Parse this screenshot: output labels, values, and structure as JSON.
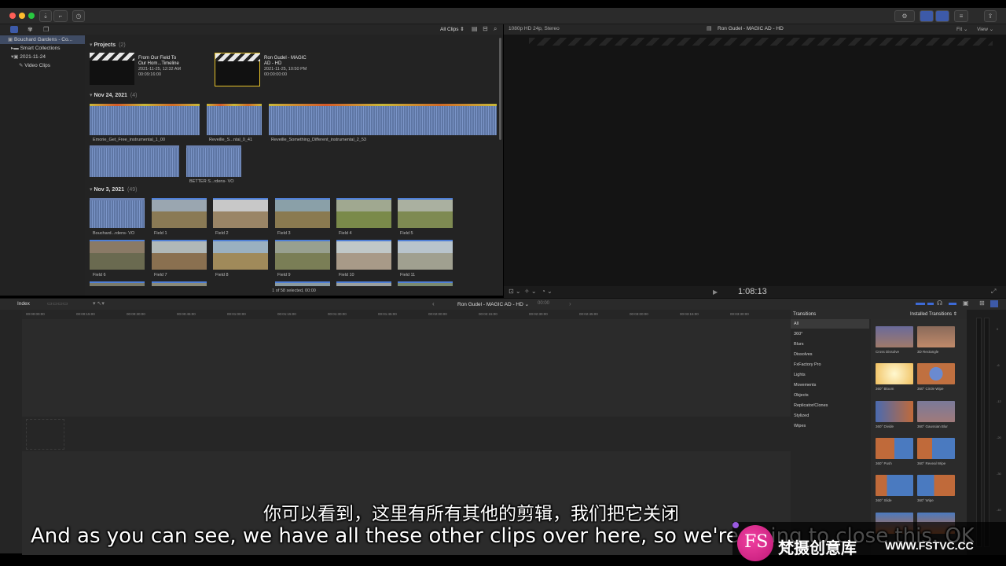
{
  "topbar": {
    "traffic_colors": [
      "#ff5f57",
      "#febc2e",
      "#28c840"
    ]
  },
  "library": {
    "items": [
      {
        "label": "Bouchard Gardens - Co...",
        "icon": "library-icon"
      },
      {
        "label": "Smart Collections",
        "icon": "folder-icon"
      },
      {
        "label": "2021-11-24",
        "icon": "event-icon"
      },
      {
        "label": "Video Clips",
        "icon": "keyword-icon"
      }
    ]
  },
  "browser": {
    "toolbar": {
      "filter": "All Clips ⇕"
    },
    "projects": {
      "label": "Projects",
      "count": "(2)",
      "items": [
        {
          "title1": "From Our Field To",
          "title2": "Our Hom...Timeline",
          "date": "2021-11-25, 12:32 AM",
          "duration": "00:09:16:00"
        },
        {
          "title1": "Ron Gudel - MAGIC",
          "title2": "AD - HD",
          "date": "2021-11-25, 10:50 PM",
          "duration": "00:00:00:00"
        }
      ]
    },
    "nov24": {
      "label": "Nov 24, 2021",
      "count": "(4)",
      "clips": [
        "Emorie_Get_Free_instrumental_1_00",
        "Reveille_S...ntal_0_41",
        "Reveille_Something_Different_instrumental_2_53",
        "BETTER S...rdens- VO"
      ]
    },
    "nov3": {
      "label": "Nov 3, 2021",
      "count": "(49)",
      "clips": [
        "Bouchard...rdens- VO",
        "Field 1",
        "Field 2",
        "Field 3",
        "Field 4",
        "Field 5",
        "Field 6",
        "Field 7",
        "Field 8",
        "Field 9",
        "Field 10",
        "Field 11"
      ]
    },
    "status": "1 of 58 selected, 00:00"
  },
  "viewer": {
    "format": "1080p HD 24p, Stereo",
    "title": "Ron Gudel - MAGIC AD - HD",
    "fit": "Fit ⌄",
    "view": "View ⌄",
    "timecode": "1:08:13"
  },
  "timeline": {
    "index": "Index",
    "project": "Ron Gudel - MAGIC AD - HD ⌄",
    "duration": "00:00",
    "ruler": [
      "00:00:00:00",
      "00:00:15:00",
      "00:00:30:00",
      "00:00:45:00",
      "00:01:00:00",
      "00:01:15:00",
      "00:01:30:00",
      "00:01:45:00",
      "00:02:00:00",
      "00:02:15:00",
      "00:02:30:00",
      "00:02:45:00",
      "00:03:00:00",
      "00:03:15:00",
      "00:03:30:00"
    ]
  },
  "transitions": {
    "title": "Transitions",
    "installed": "Installed Transitions ⇕",
    "categories": [
      "All",
      "360°",
      "Blurs",
      "Dissolves",
      "FxFactory Pro",
      "Lights",
      "Movements",
      "Objects",
      "Replicator/Clones",
      "Stylized",
      "Wipes"
    ],
    "items": [
      "Cross Dissolve",
      "3D Rectangle",
      "360° Bloom",
      "360° Circle Wipe",
      "360° Divide",
      "360° Gaussian Blur",
      "360° Push",
      "360° Reveal Wipe",
      "360° Slide",
      "360° Wipe"
    ]
  },
  "meters": [
    "0",
    "-6",
    "-12",
    "-20",
    "-30",
    "-40"
  ],
  "subtitles": {
    "cn": "你可以看到，这里有所有其他的剪辑，我们把它关闭",
    "en": "And as you can see, we have all these other clips over here, so we're going to close this. OK, so"
  },
  "watermark": {
    "logo": "FS",
    "cn": "梵摄创意库",
    "url": "WWW.FSTVC.CC"
  }
}
